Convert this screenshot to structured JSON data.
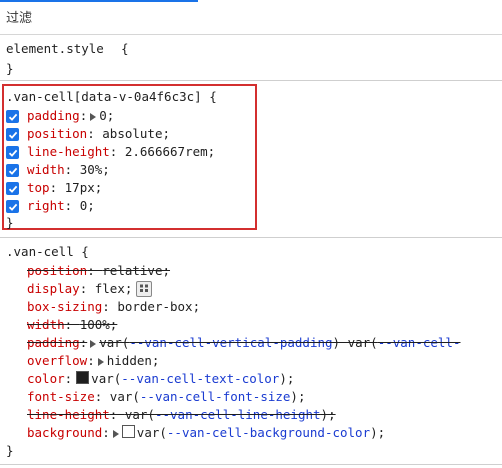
{
  "filter": {
    "placeholder": "过滤"
  },
  "element_style": {
    "selector": "element.style",
    "open": "{",
    "close": "}"
  },
  "rule1": {
    "selector": ".van-cell[data-v-0a4f6c3c]",
    "open": "{",
    "close": "}",
    "props": [
      {
        "name": "padding",
        "value": "0;",
        "expandable": true
      },
      {
        "name": "position",
        "value": "absolute;"
      },
      {
        "name": "line-height",
        "value": "2.666667rem;"
      },
      {
        "name": "width",
        "value": "30%;"
      },
      {
        "name": "top",
        "value": "17px;"
      },
      {
        "name": "right",
        "value": "0;"
      }
    ]
  },
  "rule2": {
    "selector": ".van-cell",
    "open": "{",
    "close": "}",
    "props": [
      {
        "name": "position",
        "value": "relative;",
        "struck": true
      },
      {
        "name": "display",
        "value": "flex;"
      },
      {
        "name": "box-sizing",
        "value": "border-box;"
      },
      {
        "name": "width",
        "value": "100%;",
        "struck": true
      },
      {
        "name": "padding",
        "value_pre": "var(",
        "value_var": "--van-cell-vertical-padding",
        "value_mid": ") var(",
        "value_var2": "--van-cell-",
        "struck": true
      },
      {
        "name": "overflow",
        "value": "hidden;"
      },
      {
        "name": "color",
        "value_pre": "var(",
        "value_var": "--van-cell-text-color",
        "value_post": ");",
        "swatch": "#1f1f1f"
      },
      {
        "name": "font-size",
        "value_pre": "var(",
        "value_var": "--van-cell-font-size",
        "value_post": ");"
      },
      {
        "name": "line-height",
        "value_pre": "var(",
        "value_var": "--van-cell-line-height",
        "value_post": ");",
        "struck": true
      },
      {
        "name": "background",
        "value_pre": "var(",
        "value_var": "--van-cell-background-color",
        "value_post": ");",
        "swatch": "#ffffff"
      }
    ]
  },
  "colors": {
    "accent": "#1a73e8",
    "highlight_border": "#d32f2f",
    "property": "#c80000",
    "variable": "#1a3bd1"
  }
}
